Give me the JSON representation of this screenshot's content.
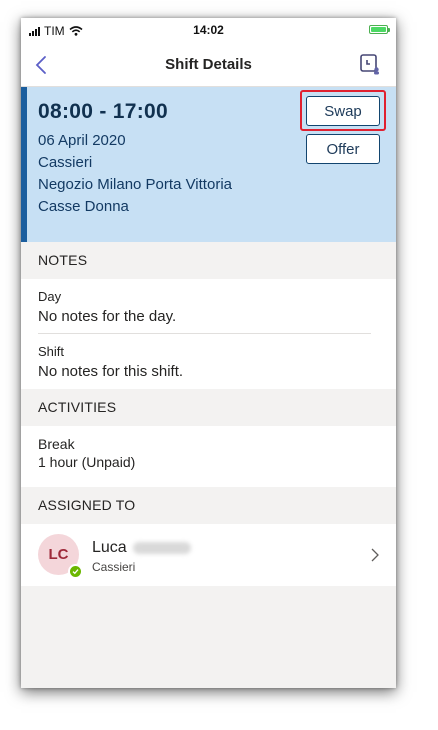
{
  "status_bar": {
    "carrier": "TIM",
    "time": "14:02"
  },
  "nav": {
    "title": "Shift Details",
    "back_icon": "chevron-left-icon",
    "action_icon": "schedule-clock-icon"
  },
  "shift": {
    "time_range": "08:00 - 17:00",
    "date": "06 April 2020",
    "role": "Cassieri",
    "location": "Negozio Milano Porta Vittoria",
    "area": "Casse Donna",
    "swap_label": "Swap",
    "offer_label": "Offer"
  },
  "notes": {
    "header": "NOTES",
    "day_label": "Day",
    "day_value": "No notes for the day.",
    "shift_label": "Shift",
    "shift_value": "No notes for this shift."
  },
  "activities": {
    "header": "ACTIVITIES",
    "items": [
      {
        "name": "Break",
        "detail": "1 hour (Unpaid)"
      }
    ]
  },
  "assigned": {
    "header": "ASSIGNED TO",
    "initials": "LC",
    "first_name": "Luca",
    "role": "Cassieri",
    "presence": "available"
  },
  "colors": {
    "accent": "#1b5e9e",
    "card_bg": "#c7e0f4",
    "highlight": "#e02030",
    "presence": "#6bb700"
  }
}
